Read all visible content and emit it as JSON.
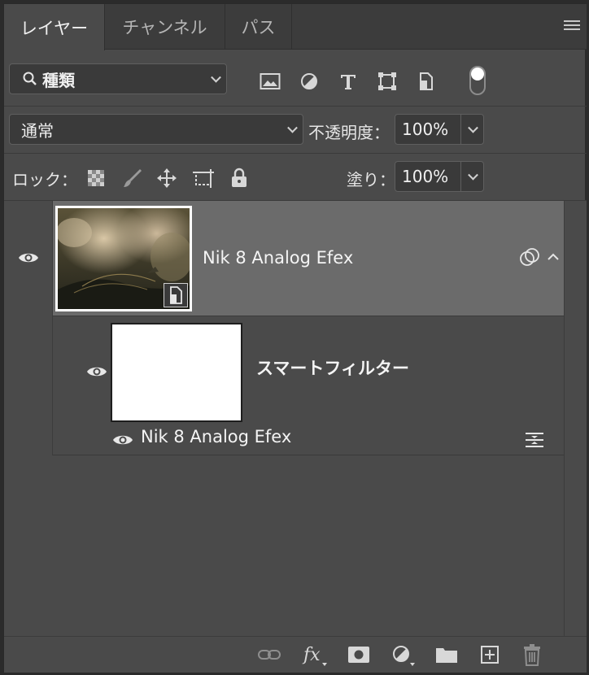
{
  "tabs": [
    {
      "label": "レイヤー",
      "active": true
    },
    {
      "label": "チャンネル",
      "active": false
    },
    {
      "label": "パス",
      "active": false
    }
  ],
  "filter": {
    "kind_label": "種類"
  },
  "blend": {
    "mode": "通常",
    "opacity_label": "不透明度：",
    "opacity_value": "100%"
  },
  "lock": {
    "label": "ロック：",
    "fill_label": "塗り：",
    "fill_value": "100%"
  },
  "layers": [
    {
      "name": "Nik 8 Analog Efex",
      "smart_filters_label": "スマートフィルター",
      "filter_name": "Nik 8 Analog Efex"
    }
  ],
  "colors": {
    "panel_bg": "#4a4a4a",
    "selected_row": "#6b6b6b",
    "tab_bar": "#3c3c3c"
  }
}
